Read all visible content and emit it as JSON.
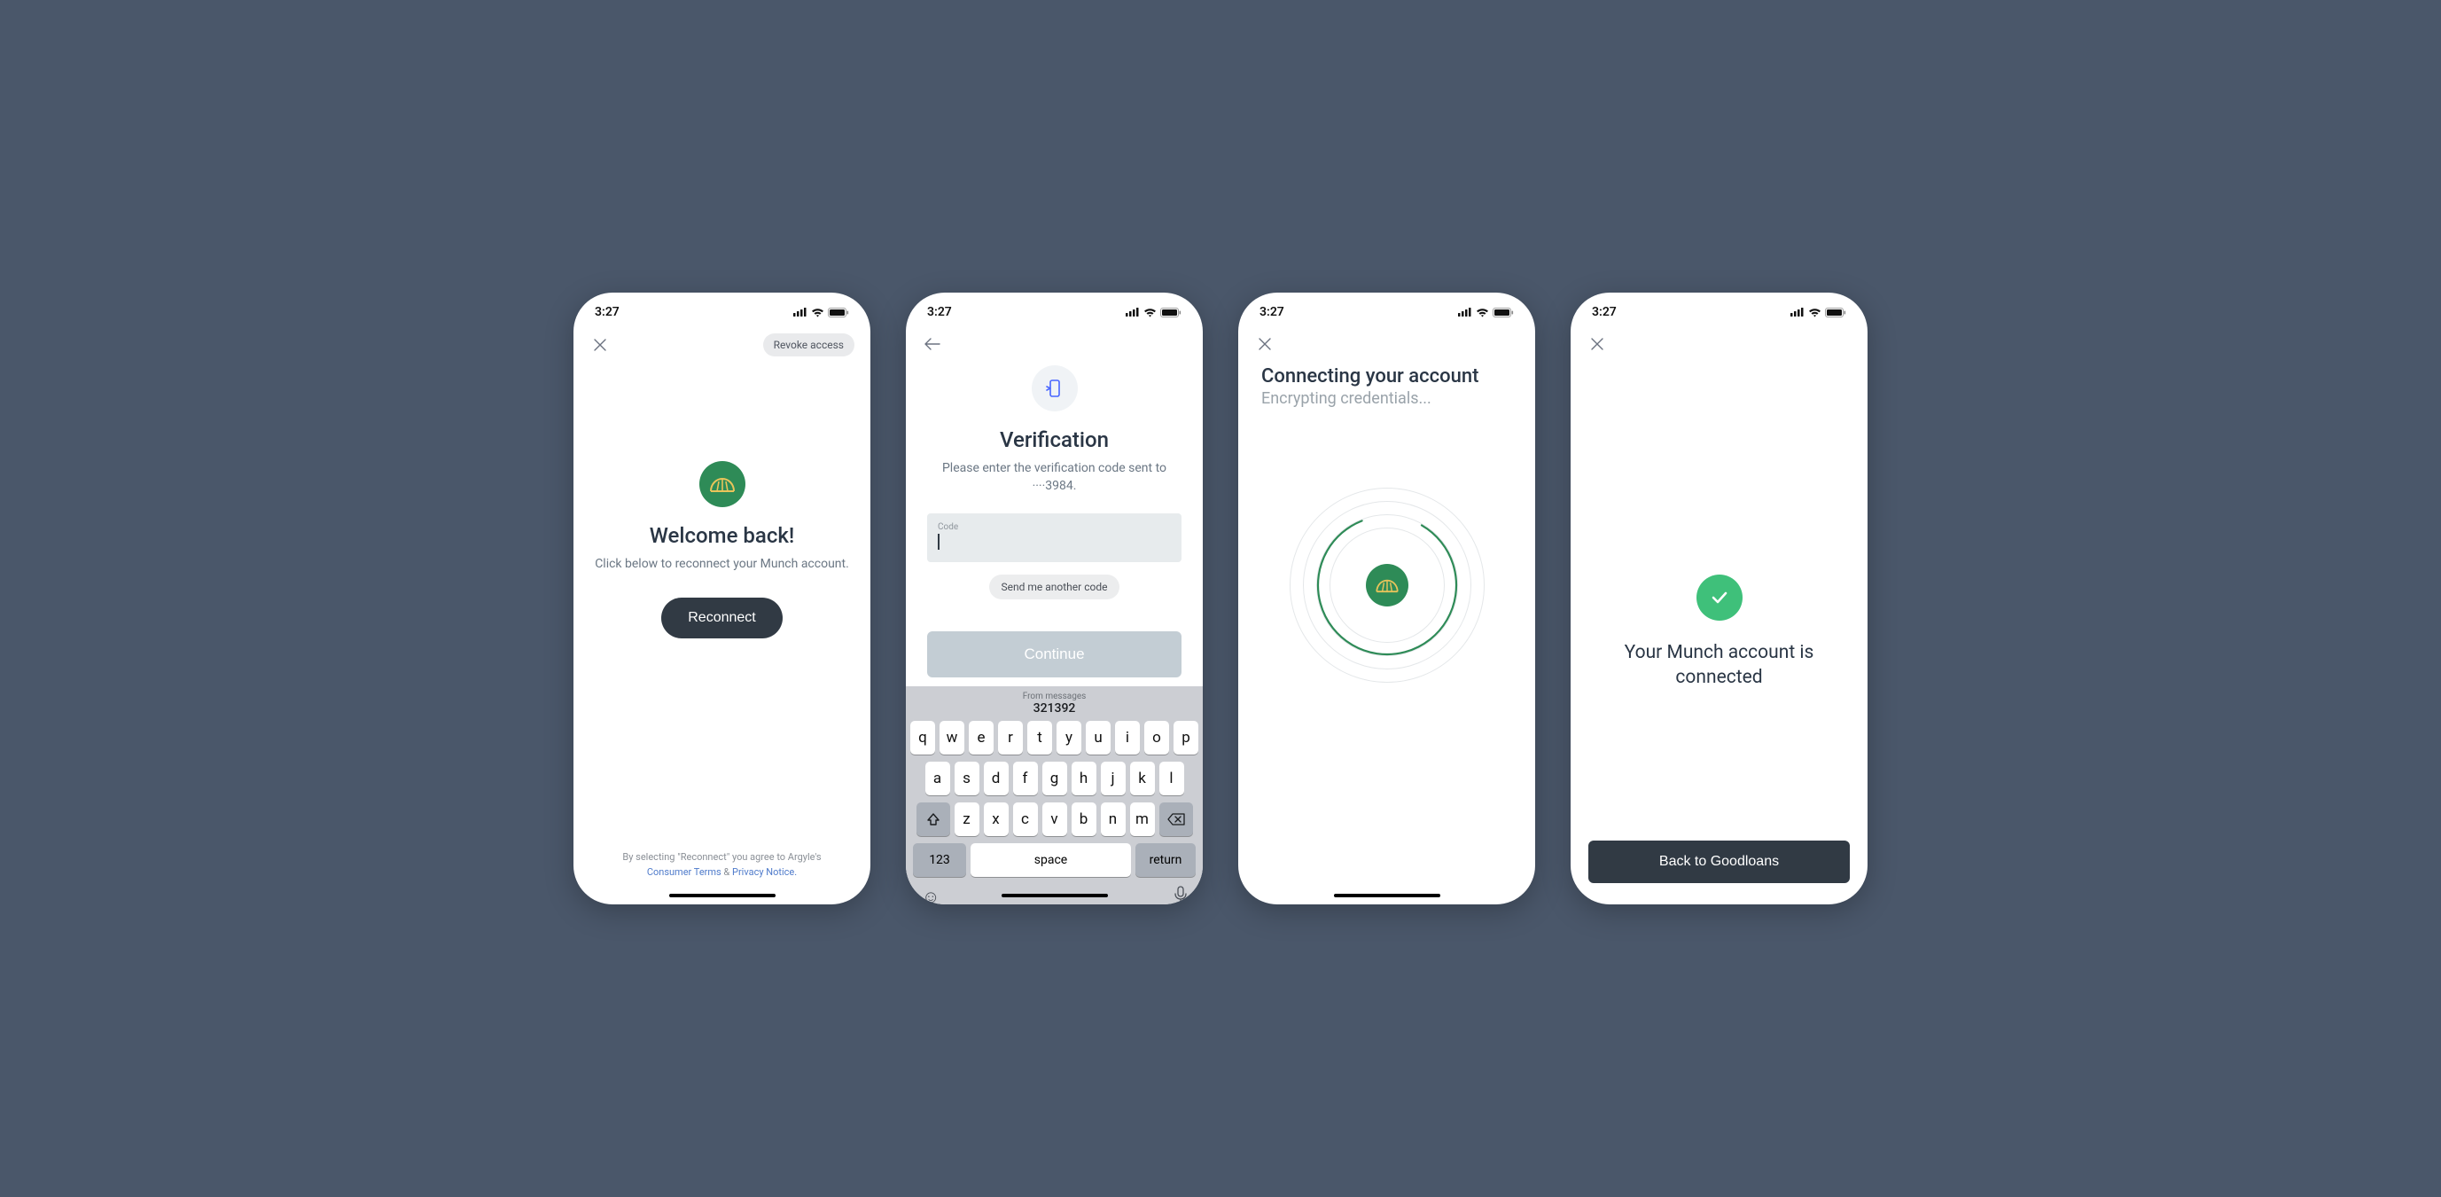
{
  "statusbar": {
    "time": "3:27"
  },
  "screen1": {
    "revoke_label": "Revoke access",
    "title": "Welcome back!",
    "subtitle": "Click below to reconnect your Munch account.",
    "cta": "Reconnect",
    "legal_intro": "By selecting \"Reconnect\" you agree to Argyle's",
    "legal_terms": "Consumer Terms",
    "legal_amp": " & ",
    "legal_privacy": "Privacy Notice."
  },
  "screen2": {
    "title": "Verification",
    "subtitle": "Please enter the verification code sent to ····3984.",
    "code_label": "Code",
    "send_another": "Send me another code",
    "continue": "Continue",
    "kb_suggestion_label": "From messages",
    "kb_suggestion_code": "321392",
    "kb_123": "123",
    "kb_space": "space",
    "kb_return": "return",
    "kb_rows": {
      "r1": [
        "q",
        "w",
        "e",
        "r",
        "t",
        "y",
        "u",
        "i",
        "o",
        "p"
      ],
      "r2": [
        "a",
        "s",
        "d",
        "f",
        "g",
        "h",
        "j",
        "k",
        "l"
      ],
      "r3": [
        "z",
        "x",
        "c",
        "v",
        "b",
        "n",
        "m"
      ]
    }
  },
  "screen3": {
    "title": "Connecting your account",
    "subtitle": "Encrypting credentials..."
  },
  "screen4": {
    "message": "Your Munch account is connected",
    "cta": "Back to Goodloans"
  }
}
